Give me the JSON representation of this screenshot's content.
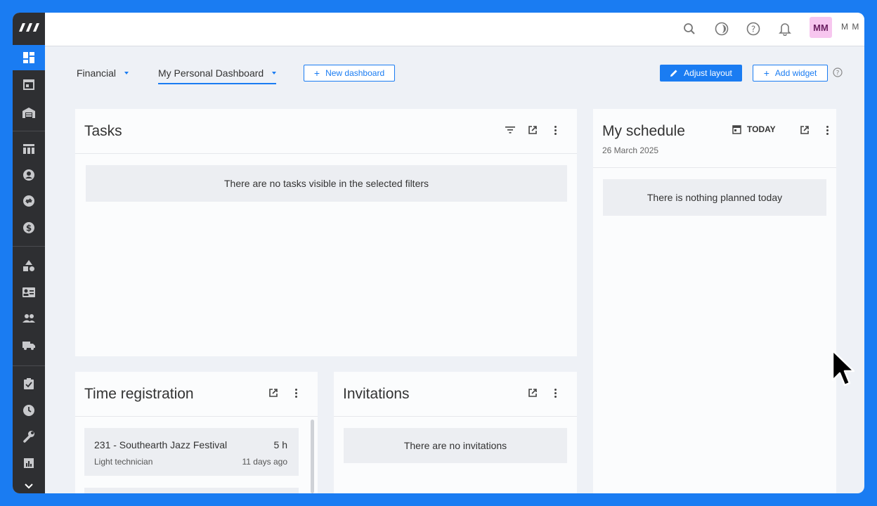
{
  "topbar": {
    "icons": [
      "search-icon",
      "theme-icon",
      "help-icon",
      "bell-icon"
    ],
    "avatar_initials": "MM",
    "username": "M M"
  },
  "sidebar": {
    "icons": [
      "dashboard-icon",
      "calendar-icon",
      "warehouse-icon",
      "table-icon",
      "contact-icon",
      "exchange-icon",
      "money-icon",
      "shapes-icon",
      "id-card-icon",
      "people-icon",
      "truck-icon",
      "clipboard-icon",
      "clock-icon",
      "wrench-icon",
      "chart-icon",
      "chevron-down-icon"
    ]
  },
  "dashboard_bar": {
    "tab_financial": "Financial",
    "tab_personal": "My Personal Dashboard",
    "new_dashboard": "New dashboard",
    "adjust_layout": "Adjust layout",
    "add_widget": "Add widget"
  },
  "tasks": {
    "title": "Tasks",
    "empty": "There are no tasks visible in the selected filters"
  },
  "schedule": {
    "title": "My schedule",
    "today_label": "TODAY",
    "date": "26 March 2025",
    "empty": "There is nothing planned today"
  },
  "time_registration": {
    "title": "Time registration",
    "items": [
      {
        "project": "231 - Southearth Jazz Festival",
        "hours": "5 h",
        "role": "Light technician",
        "when": "11 days ago"
      }
    ]
  },
  "invitations": {
    "title": "Invitations",
    "empty": "There are no invitations"
  },
  "colors": {
    "accent": "#1a7cf2",
    "sidebar": "#2e2f32",
    "avatar_bg": "#f7c6ef"
  }
}
